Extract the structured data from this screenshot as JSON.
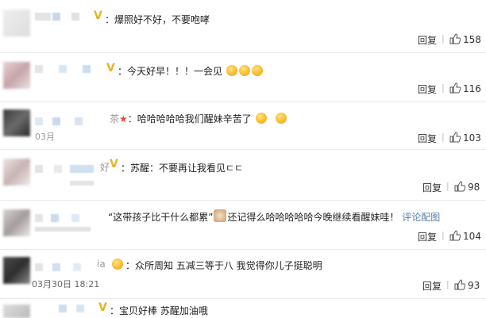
{
  "comments": [
    {
      "text": "：爆照好不好，不要咆哮",
      "reply": "回复",
      "likes": "158"
    },
    {
      "text": "：今天好早！！！一会见",
      "reply": "回复",
      "likes": "116"
    },
    {
      "name_fragment": "茶",
      "text": "：哈哈哈哈哈我们醒妹辛苦了",
      "reply": "回复",
      "likes": "103"
    },
    {
      "name_fragment": "好",
      "text": "：苏醒：不要再让我看见",
      "tail": "ㄷㄷ",
      "reply": "回复",
      "likes": "98"
    },
    {
      "quote": "“这带孩子比干什么都累”",
      "text": "还记得么哈哈哈哈哈今晚继续看醒妹哇！",
      "link": "评论配图",
      "reply": "回复",
      "likes": "104"
    },
    {
      "name_fragment": "ia",
      "text": "：众所周知 五减三等于八 我觉得你儿子挺聪明",
      "time": "03月30日 18:21",
      "reply": "回复",
      "likes": "93"
    },
    {
      "text": "：宝贝好棒 苏醒加油哦"
    }
  ],
  "fragments": {
    "row3_time": "03月",
    "row4_time": ""
  },
  "icons": {
    "like": "thumbs-up-icon",
    "verified": "v-badge-icon",
    "emoji": "emoji-icon",
    "star": "star-icon"
  },
  "colors": {
    "link": "#5b7ca8",
    "badge": "#e6b422",
    "star": "#e04a2a"
  }
}
